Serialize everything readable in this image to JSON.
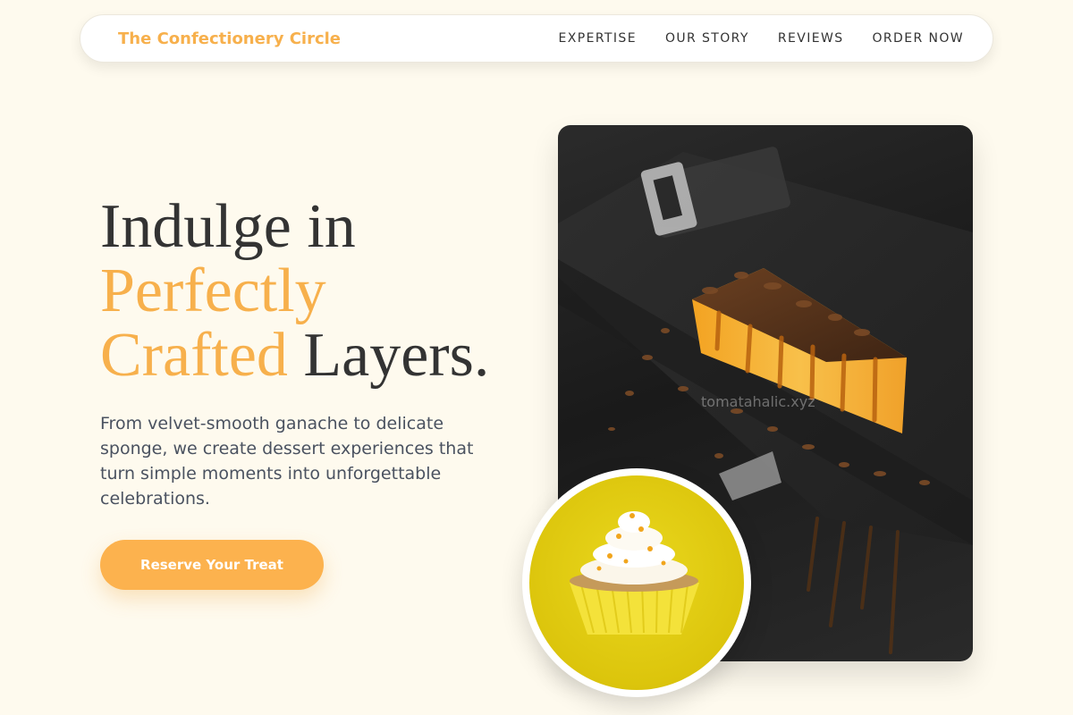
{
  "nav": {
    "brand": "The Confectionery Circle",
    "links": [
      "EXPERTISE",
      "OUR STORY",
      "REVIEWS",
      "ORDER NOW"
    ]
  },
  "hero": {
    "title_line1": "Indulge in",
    "title_accent1": "Perfectly",
    "title_accent2": "Crafted",
    "title_rest": " Layers.",
    "description": "From velvet-smooth ganache to delicate sponge, we create dessert experiences that turn simple moments into unforgettable celebrations.",
    "cta_label": "Reserve Your Treat"
  },
  "images": {
    "main_watermark": "tomatahalic.xyz"
  },
  "colors": {
    "background": "#fefaee",
    "accent": "#f7b04c",
    "cta": "#fcb24e",
    "heading": "#333333",
    "body_text": "#4a5260"
  }
}
